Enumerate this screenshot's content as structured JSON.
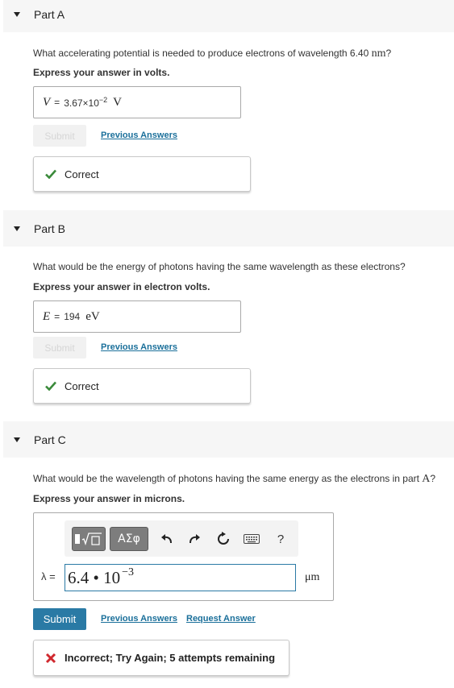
{
  "partA": {
    "title": "Part A",
    "question_pre": "What accelerating potential is needed to produce electrons of wavelength 6.40 ",
    "question_unit": "nm",
    "question_post": "?",
    "instruction": "Express your answer in volts.",
    "answer": {
      "variable": "V",
      "equals": "=",
      "mantissa": "3.67×10",
      "exponent": "−2",
      "unit": "V"
    },
    "submit_label": "Submit",
    "previous_answers_label": "Previous Answers",
    "feedback": "Correct"
  },
  "partB": {
    "title": "Part B",
    "question": "What would be the energy of photons having the same wavelength as these electrons?",
    "instruction": "Express your answer in electron volts.",
    "answer": {
      "variable": "E",
      "equals": "=",
      "value": "194",
      "unit": "eV"
    },
    "submit_label": "Submit",
    "previous_answers_label": "Previous Answers",
    "feedback": "Correct"
  },
  "partC": {
    "title": "Part C",
    "question_pre": "What would be the wavelength of photons having the same energy as the electrons in part ",
    "question_ref": "A",
    "question_post": "?",
    "instruction": "Express your answer in microns.",
    "toolbar": {
      "template_icon": "▮√▢",
      "greek_label": "ΑΣφ",
      "help_label": "?"
    },
    "variable_label": "λ =",
    "input_mantissa": "6.4 • 10",
    "input_exponent": "−3",
    "unit": "μm",
    "submit_label": "Submit",
    "previous_answers_label": "Previous Answers",
    "request_answer_label": "Request Answer",
    "feedback": "Incorrect; Try Again; 5 attempts remaining"
  },
  "colors": {
    "link": "#1a6f9a",
    "submit_active": "#2a7aa5",
    "correct": "#3a8a3a",
    "incorrect": "#d0282e"
  }
}
